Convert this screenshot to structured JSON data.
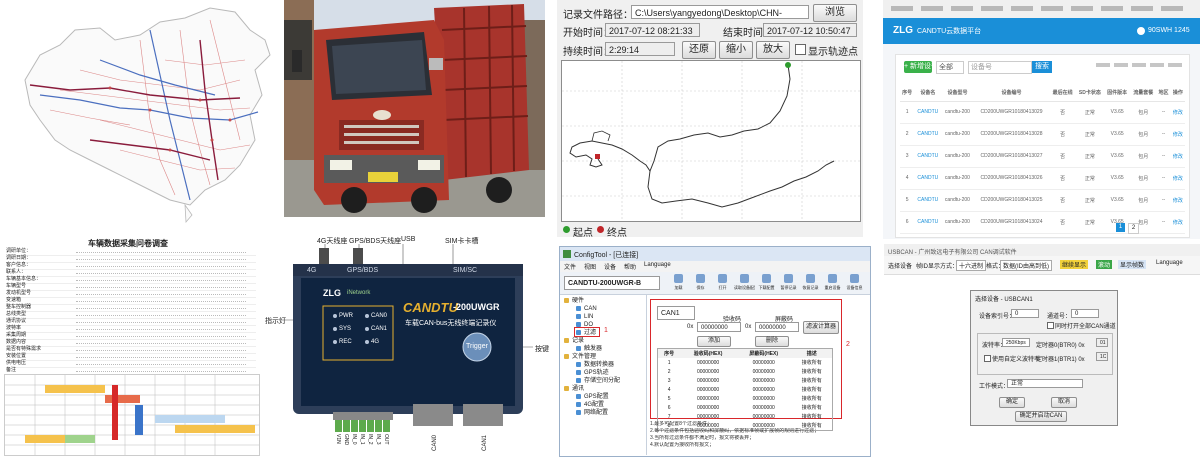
{
  "trace": {
    "file_label": "记录文件路径：",
    "file_path": "C:\\Users\\yangyedong\\Desktop\\CHN-STACK",
    "browse": "浏览",
    "start_label": "开始时间：",
    "start_value": "2017-07-12 08:21:33",
    "end_label": "结束时间：",
    "end_value": "2017-07-12 10:50:47",
    "duration_label": "持续时间：",
    "duration_value": "2:29:14",
    "restore": "还原",
    "zoom_out": "缩小",
    "zoom_in": "放大",
    "show_points": "显示轨迹点",
    "legend_start": "起点",
    "legend_end": "终点",
    "colors": {
      "start": "#2e9c2e",
      "end": "#c0262a"
    }
  },
  "web": {
    "logo": "ZLG",
    "title": "CANDTU云数据平台",
    "user": "90SWH 1245",
    "add_button": "+ 新增设备",
    "select": "全部",
    "search_placeholder": "设备号",
    "search_button": "搜索",
    "columns": [
      "序号",
      "设备名",
      "设备型号",
      "设备编号",
      "最后在线",
      "SD卡状态",
      "固件版本",
      "流量套餐",
      "地区",
      "操作"
    ],
    "rows": [
      [
        "1",
        "CANDTU",
        "candtu-200",
        "CD200UWGR10180413029",
        "否",
        "正常",
        "V3.65",
        "包月",
        "--",
        "修改"
      ],
      [
        "2",
        "CANDTU",
        "candtu-200",
        "CD200UWGR10180413028",
        "否",
        "正常",
        "V3.65",
        "包月",
        "--",
        "修改"
      ],
      [
        "3",
        "CANDTU",
        "candtu-200",
        "CD200UWGR10180413027",
        "否",
        "正常",
        "V3.65",
        "包月",
        "--",
        "修改"
      ],
      [
        "4",
        "CANDTU",
        "candtu-200",
        "CD200UWGR10180413026",
        "否",
        "正常",
        "V3.65",
        "包月",
        "--",
        "修改"
      ],
      [
        "5",
        "CANDTU",
        "candtu-200",
        "CD200UWGR10180413025",
        "否",
        "正常",
        "V3.65",
        "包月",
        "--",
        "修改"
      ],
      [
        "6",
        "CANDTU",
        "candtu-200",
        "CD200UWGR10180413024",
        "否",
        "正常",
        "V3.65",
        "包月",
        "--",
        "修改"
      ]
    ],
    "pages": [
      "1",
      "2"
    ],
    "accent": "#1a8fd8",
    "add_color": "#3ab14a"
  },
  "doc": {
    "title": "车辆数据采集问卷调查",
    "lines": [
      "调研单位：",
      "调研日期：",
      "客户信息：",
      "联系人：",
      "车辆基本信息：",
      "车辆型号",
      "发动机型号",
      "变速箱",
      "整车控制器",
      "总线类型",
      "通讯协议",
      "波特率",
      "采集周期",
      "数据内容",
      "是否有特殊需求",
      "安装位置",
      "供电电压",
      "备注"
    ]
  },
  "device": {
    "label_4g_ant": "4G天线座",
    "label_gps_ant": "GPS/BDS天线座",
    "label_usb": "USB",
    "label_sim": "SIM卡卡槽",
    "label_led": "指示灯",
    "label_key": "按键",
    "brand": "CANDTU",
    "model": "-200UWGR",
    "subtitle": "车载CAN-bus无线终端记录仪",
    "trigger": "Trigger",
    "led_pwr": "PWR",
    "led_sys": "SYS",
    "led_rec": "REC",
    "led_can0": "CAN0",
    "led_can1": "CAN1",
    "led_4g": "4G",
    "top_4g": "4G",
    "top_gps": "GPS/BDS",
    "top_simsc": "SIM/SC",
    "logo_sub": "iNetwork",
    "pins": [
      "V1N",
      "GND",
      "IN_0",
      "IN_1",
      "IN_2",
      "IN_3",
      "OUT"
    ],
    "bottom_left": "CAN0",
    "bottom_right": "CAN1",
    "zlg": "ZLG"
  },
  "config": {
    "title": "ConfigTool - [已连接]",
    "menu": [
      "文件",
      "视图",
      "设备",
      "帮助",
      "Language"
    ],
    "toolbar": [
      "加载",
      "保存",
      "打开",
      "读取设备配置",
      "下载配置",
      "暂停记录",
      "恢复记录",
      "重启设备",
      "设备信息"
    ],
    "device_select": "CANDTU-200UWGR-B",
    "tree": [
      {
        "label": "硬件",
        "indent": 0
      },
      {
        "label": "CAN",
        "indent": 1
      },
      {
        "label": "LIN",
        "indent": 1
      },
      {
        "label": "DO",
        "indent": 1
      },
      {
        "label": "过滤",
        "indent": 1
      },
      {
        "label": "记录",
        "indent": 0
      },
      {
        "label": "触发器",
        "indent": 1
      },
      {
        "label": "文件管理",
        "indent": 0
      },
      {
        "label": "数据转换器",
        "indent": 1
      },
      {
        "label": "GPS轨迹",
        "indent": 1
      },
      {
        "label": "存储空间分配",
        "indent": 1
      },
      {
        "label": "通讯",
        "indent": 0
      },
      {
        "label": "GPS配置",
        "indent": 1
      },
      {
        "label": "4G配置",
        "indent": 1
      },
      {
        "label": "网络配置",
        "indent": 1
      }
    ],
    "marker_1": "1",
    "marker_2": "2",
    "can_select": "CAN1",
    "acc_code_label": "验收码",
    "mask_label": "屏蔽码",
    "hex_prefix": "0x",
    "acc_code_value": "00000000",
    "mask_value": "00000000",
    "calc_button": "滤波计算器",
    "add_button": "添加",
    "delete_button": "删除",
    "columns": [
      "序号",
      "验收码(HEX)",
      "屏蔽码(HEX)",
      "描述"
    ],
    "rows": [
      [
        "1",
        "00000000",
        "00000000",
        "接收所有"
      ],
      [
        "2",
        "00000000",
        "00000000",
        "接收所有"
      ],
      [
        "3",
        "00000000",
        "00000000",
        "接收所有"
      ],
      [
        "4",
        "00000000",
        "00000000",
        "接收所有"
      ],
      [
        "5",
        "00000000",
        "00000000",
        "接收所有"
      ],
      [
        "6",
        "00000000",
        "00000000",
        "接收所有"
      ],
      [
        "7",
        "00000000",
        "00000000",
        "接收所有"
      ],
      [
        "8",
        "00000000",
        "00000000",
        "接收所有"
      ]
    ],
    "notes": [
      "1.最多可配置8个过滤条件；",
      "2.每个过滤条件包括验收码和屏蔽码，依据标准帧或扩展帧的规则进行过滤；",
      "3.当所有过滤条件都不满足时，报文将被丢弃；",
      "4.默认配置为接收所有报文；"
    ],
    "highlight": "#d9272b"
  },
  "dialog": {
    "app_title": "USBCAN - 广州致远电子有限公司 CAN调试软件",
    "toolbar": [
      "选择设备",
      "帧ID显示方式：",
      "十六进制",
      "格式：",
      "数据(ID由高到低)",
      "继续显示",
      "滚动",
      "显示帧数",
      "Language"
    ],
    "title": "选择设备 - USBCAN1",
    "dev_index_label": "设备索引号：",
    "dev_index_value": "0",
    "channel_label": "通道号：",
    "channel_value": "0",
    "sync_can": "同时打开全部CAN通道",
    "baud_label": "波特率：",
    "baud_value": "250Kbps",
    "timing0_label": "定时器0(BTR0) 0x",
    "timing0_value": "01",
    "custom_baud": "使用自定义波特率",
    "timing1_label": "定时器1(BTR1) 0x",
    "timing1_value": "1C",
    "mode_label": "工作模式：",
    "mode_value": "正常",
    "ok": "确定",
    "cancel": "取消",
    "ok_start": "确定并启动CAN"
  }
}
